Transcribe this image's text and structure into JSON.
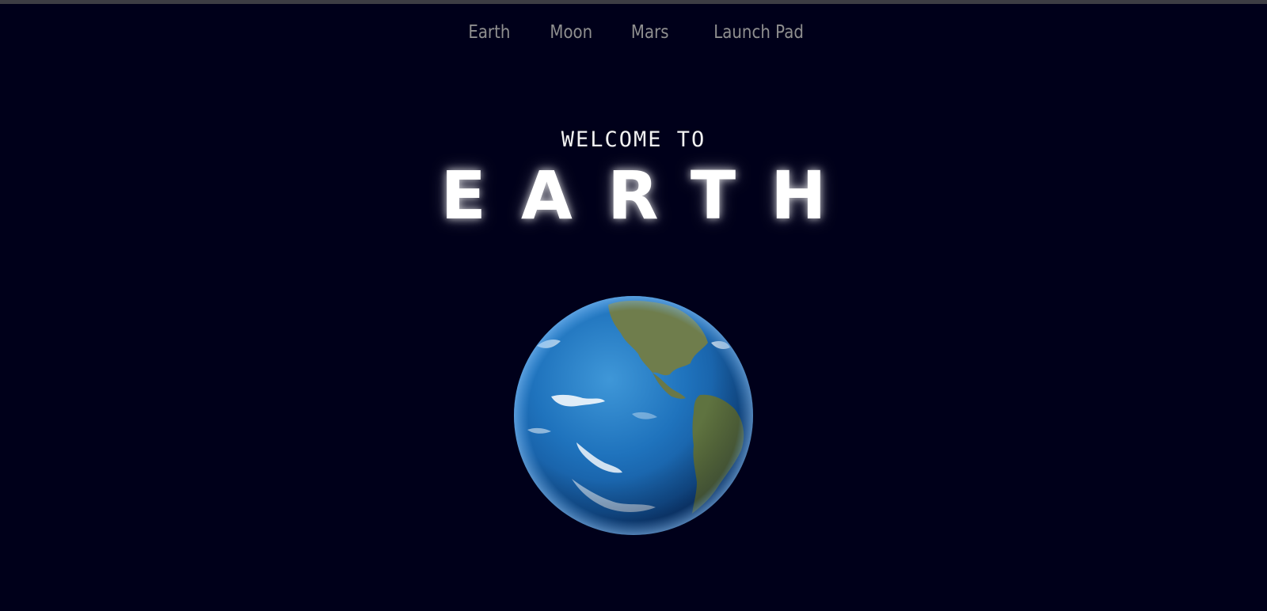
{
  "nav": {
    "items": [
      {
        "label": "Earth"
      },
      {
        "label": "Moon"
      },
      {
        "label": "Mars"
      },
      {
        "label": "Launch Pad"
      }
    ]
  },
  "hero": {
    "welcome": "WELCOME TO",
    "title": "EARTH"
  },
  "colors": {
    "background": "#00001a",
    "nav_text": "#8f8f8f",
    "title_text": "#ffffff",
    "ocean": "#1a6bb8",
    "land": "#6b7a4a"
  },
  "image": {
    "icon": "earth-globe"
  }
}
